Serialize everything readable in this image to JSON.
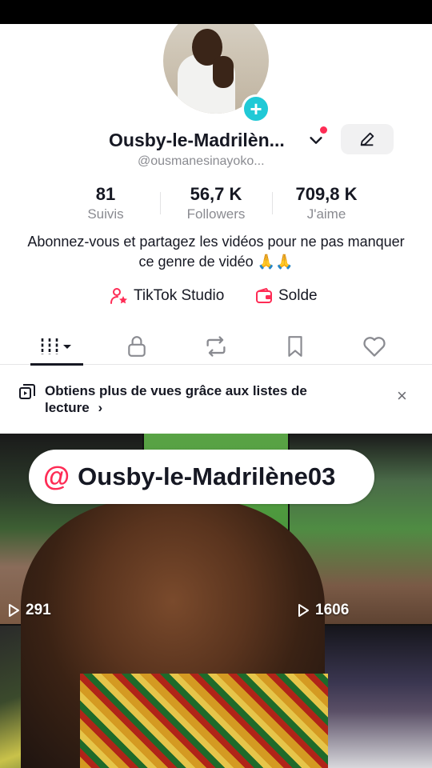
{
  "profile": {
    "display_name": "Ousby-le-Madrilèn...",
    "handle": "@ousmanesinayoko...",
    "stats": [
      {
        "value": "81",
        "label": "Suivis"
      },
      {
        "value": "56,7 K",
        "label": "Followers"
      },
      {
        "value": "709,8 K",
        "label": "J'aime"
      }
    ],
    "bio": "Abonnez-vous et partagez les vidéos pour ne pas manquer ce genre de vidéo 🙏🙏",
    "links": {
      "studio": "TikTok Studio",
      "solde": "Solde"
    }
  },
  "banner": {
    "text": "Obtiens plus de vues grâce aux listes de lecture",
    "chevron": "›",
    "close": "×"
  },
  "overlay": {
    "at": "@",
    "mention": "Ousby-le-Madrilène03"
  },
  "grid": {
    "views": [
      "291",
      "1606"
    ]
  },
  "icons": {
    "plus": "+",
    "accent": "#fe2c55",
    "badge_color": "#20c9d6"
  }
}
